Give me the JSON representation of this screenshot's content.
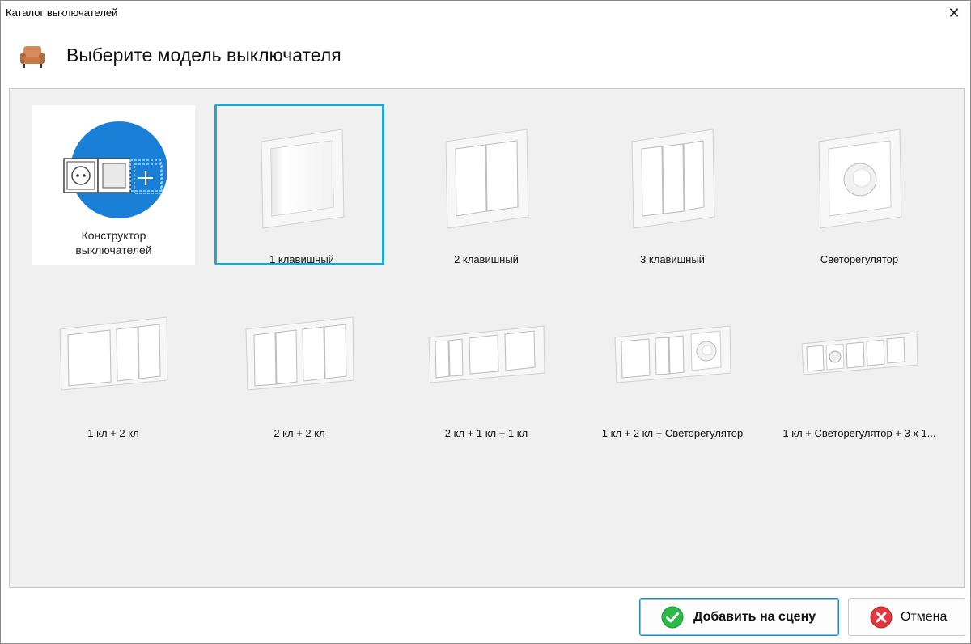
{
  "window": {
    "title": "Каталог выключателей",
    "close_glyph": "✕"
  },
  "header": {
    "title": "Выберите модель выключателя",
    "icon": "armchair-icon"
  },
  "constructor_tile": {
    "label_line1": "Конструктор",
    "label_line2": "выключателей"
  },
  "models": [
    {
      "label": "1 клавишный",
      "selected": true
    },
    {
      "label": "2 клавишный",
      "selected": false
    },
    {
      "label": "3 клавишный",
      "selected": false
    },
    {
      "label": "Светорегулятор",
      "selected": false
    },
    {
      "label": "1 кл + 2 кл",
      "selected": false
    },
    {
      "label": "2 кл + 2 кл",
      "selected": false
    },
    {
      "label": "2 кл + 1 кл + 1 кл",
      "selected": false
    },
    {
      "label": "1 кл + 2 кл + Светорегулятор",
      "selected": false
    },
    {
      "label": "1 кл + Светорегулятор + 3 х 1...",
      "selected": false
    }
  ],
  "footer": {
    "add_label": "Добавить на сцену",
    "cancel_label": "Отмена"
  },
  "colors": {
    "selection": "#1fa7cf",
    "constructor_circle": "#1a7fd6",
    "ok_green": "#2db84a",
    "cancel_red": "#e2373d"
  }
}
